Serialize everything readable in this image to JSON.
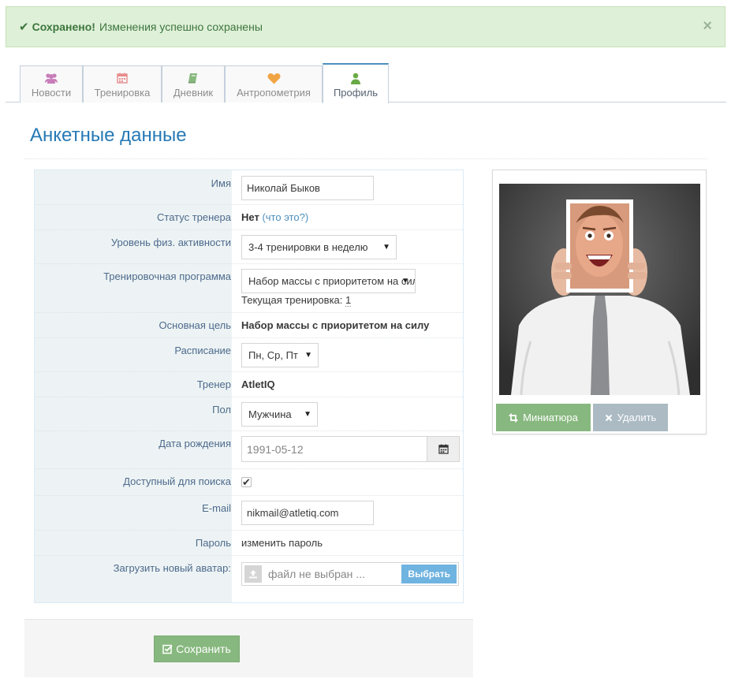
{
  "alert": {
    "strong": "Сохранено!",
    "message": "Изменения успешно сохранены",
    "close": "×"
  },
  "tabs": [
    {
      "label": "Новости",
      "icon": "users-icon",
      "color": "#c87cb9"
    },
    {
      "label": "Тренировка",
      "icon": "calendar-icon",
      "color": "#e88b8b"
    },
    {
      "label": "Дневник",
      "icon": "book-icon",
      "color": "#87b87f"
    },
    {
      "label": "Антропометрия",
      "icon": "heart-icon",
      "color": "#f0a545"
    },
    {
      "label": "Профиль",
      "icon": "user-icon",
      "color": "#69aa46",
      "active": true
    }
  ],
  "page_title": "Анкетные данные",
  "form": {
    "name": {
      "label": "Имя",
      "value": "Николай Быков"
    },
    "trainer_status": {
      "label": "Статус тренера",
      "value": "Нет",
      "help_link": "(что это?)"
    },
    "activity": {
      "label": "Уровень физ. активности",
      "value": "3-4 тренировки в неделю"
    },
    "program": {
      "label": "Тренировочная программа",
      "value": "Набор массы с приоритетом на силу",
      "current_label": "Текущая тренировка:",
      "current_value": "1"
    },
    "goal": {
      "label": "Основная цель",
      "value": "Набор массы с приоритетом на силу"
    },
    "schedule": {
      "label": "Расписание",
      "value": "Пн, Ср, Пт"
    },
    "trainer": {
      "label": "Тренер",
      "value": "AtletIQ"
    },
    "gender": {
      "label": "Пол",
      "value": "Мужчина"
    },
    "birthdate": {
      "label": "Дата рождения",
      "value": "1991-05-12"
    },
    "searchable": {
      "label": "Доступный для поиска",
      "checked": true
    },
    "email": {
      "label": "E-mail",
      "value": "nikmail@atletiq.com"
    },
    "password": {
      "label": "Пароль",
      "link": "изменить пароль"
    },
    "avatar_upload": {
      "label": "Загрузить новый аватар:",
      "placeholder": "файл не выбран ...",
      "button": "Выбрать"
    }
  },
  "save_button": "Сохранить",
  "avatar": {
    "thumbnail_button": "Миниатюра",
    "delete_button": "Удалить"
  },
  "colors": {
    "accent": "#2679b5",
    "success": "#87b87f",
    "label": "#4d6a8c"
  }
}
